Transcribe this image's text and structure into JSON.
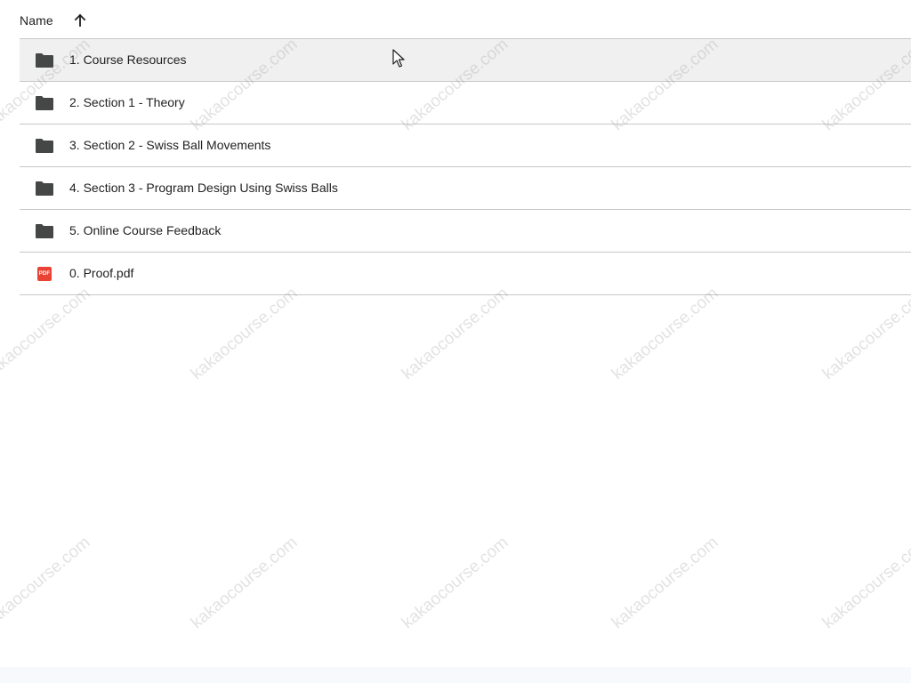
{
  "header": {
    "name_label": "Name",
    "sort_icon": "arrow-up-icon"
  },
  "files": [
    {
      "name": "1. Course Resources",
      "type": "folder",
      "icon": "folder-icon",
      "selected": true
    },
    {
      "name": "2. Section 1 - Theory",
      "type": "folder",
      "icon": "folder-icon"
    },
    {
      "name": "3. Section 2 - Swiss Ball Movements",
      "type": "folder",
      "icon": "folder-icon"
    },
    {
      "name": "4. Section 3 - Program Design Using Swiss Balls",
      "type": "folder",
      "icon": "folder-icon"
    },
    {
      "name": "5. Online Course Feedback",
      "type": "folder",
      "icon": "folder-icon"
    },
    {
      "name": "0. Proof.pdf",
      "type": "pdf",
      "icon": "pdf-icon",
      "badge": "PDF"
    }
  ],
  "watermark": {
    "text": "kakaocourse.com"
  },
  "colors": {
    "folder": "#444746",
    "pdf": "#ea4335",
    "selected_row": "#f0f0f0",
    "divider": "#c7c7c7"
  }
}
